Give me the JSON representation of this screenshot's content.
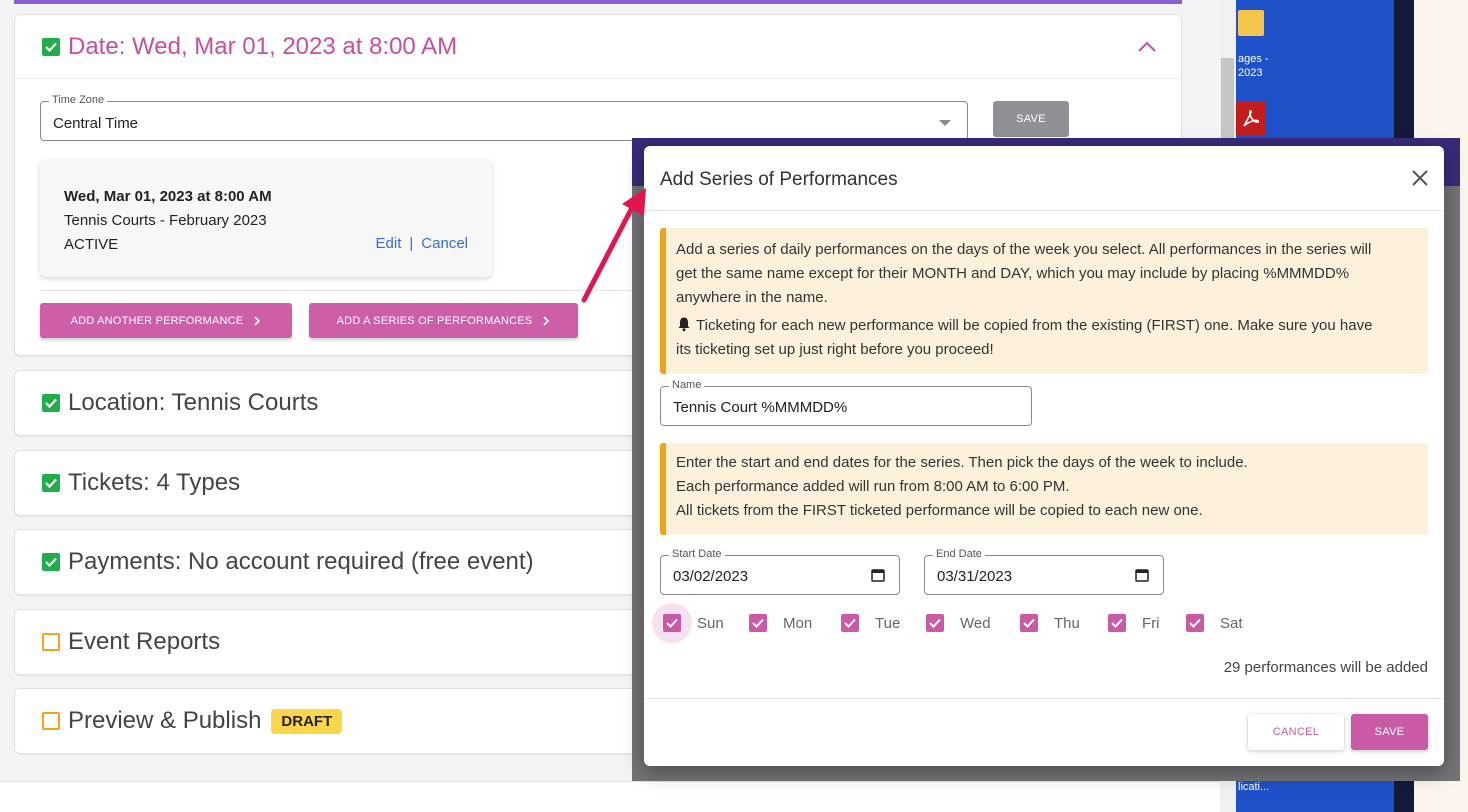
{
  "date_section": {
    "title": "Date: Wed, Mar 01, 2023 at 8:00 AM",
    "timezone_label": "Time Zone",
    "timezone_value": "Central Time",
    "save_label": "SAVE",
    "performance": {
      "datetime": "Wed, Mar 01, 2023 at 8:00 AM",
      "name": "Tennis Courts - February 2023",
      "status": "ACTIVE",
      "edit_label": "Edit",
      "separator": "|",
      "cancel_label": "Cancel"
    },
    "add_another_label": "ADD ANOTHER PERFORMANCE",
    "add_series_label": "ADD A SERIES OF PERFORMANCES"
  },
  "sections": [
    {
      "title": "Location: Tennis Courts",
      "done": true
    },
    {
      "title": "Tickets: 4 Types",
      "done": true
    },
    {
      "title": "Payments: No account required (free event)",
      "done": true
    },
    {
      "title": "Event Reports",
      "done": false
    },
    {
      "title": "Preview & Publish",
      "done": false,
      "badge": "DRAFT"
    }
  ],
  "desktop": {
    "folder_caption": "ages -\n2023",
    "taskbar_caption": "licati..."
  },
  "modal": {
    "title": "Add Series of Performances",
    "info1_line1": "Add a series of daily performances on the days of the week you select. All performances in the series will",
    "info1_line2": "get the same name except for their MONTH and DAY, which you may include by placing %MMMDD%",
    "info1_line3": "anywhere in the name.",
    "info1_line4": "Ticketing for each new performance will be copied from the existing (FIRST) one. Make sure you have",
    "info1_line5": "its ticketing set up just right before you proceed!",
    "name_label": "Name",
    "name_value": "Tennis Court %MMMDD%",
    "info2_line1": "Enter the start and end dates for the series. Then pick the days of the week to include.",
    "info2_line2": "Each performance added will run from 8:00 AM to 6:00 PM.",
    "info2_line3": "All tickets from the FIRST ticketed performance will be copied to each new one.",
    "start_label": "Start Date",
    "start_value": "03/02/2023",
    "end_label": "End Date",
    "end_value": "03/31/2023",
    "days": [
      "Sun",
      "Mon",
      "Tue",
      "Wed",
      "Thu",
      "Fri",
      "Sat"
    ],
    "days_checked": [
      true,
      true,
      true,
      true,
      true,
      true,
      true
    ],
    "count_text": "29 performances will be added",
    "cancel_label": "CANCEL",
    "save_label": "SAVE"
  },
  "colors": {
    "accent_pink": "#c95aa6",
    "check_green": "#1fae4b",
    "pending_orange": "#f0a21b",
    "annotation_arrow": "#e0174f"
  }
}
